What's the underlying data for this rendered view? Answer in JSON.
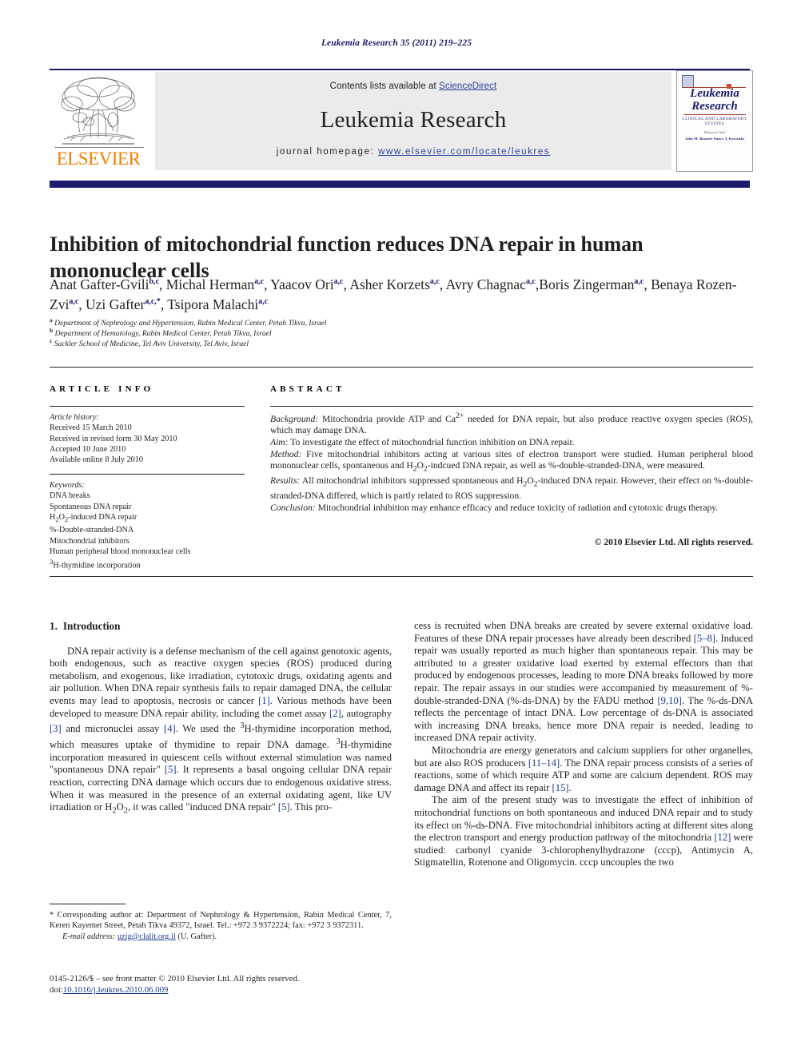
{
  "running_head": "Leukemia Research 35 (2011) 219–225",
  "masthead": {
    "contents_prefix": "Contents lists available at ",
    "sciencedirect": "ScienceDirect",
    "journal_name": "Leukemia Research",
    "homepage_prefix": "journal homepage: ",
    "homepage_url": "www.elsevier.com/locate/leukres",
    "publisher_logo_text": "ELSEVIER",
    "cover": {
      "title_line1": "Leukemia",
      "title_line2": "Research",
      "subtitle": "CLINICAL AND LABORATORY STUDIES",
      "editor_label": "Editors-in-Chief",
      "editor_names": "John M. Bennett    Nancy J. Kowalski"
    }
  },
  "article": {
    "title": "Inhibition of mitochondrial function reduces DNA repair in human mononuclear cells",
    "authors": [
      {
        "name": "Anat Gafter-Gvili",
        "marks": "b,c",
        "sep": ", "
      },
      {
        "name": "Michal Herman",
        "marks": "a,c",
        "sep": ", "
      },
      {
        "name": "Yaacov Ori",
        "marks": "a,c",
        "sep": ", "
      },
      {
        "name": "Asher Korzets",
        "marks": "a,c",
        "sep": ", "
      },
      {
        "name": "Avry Chagnac",
        "marks": "a,c",
        "sep": ","
      },
      {
        "name": "Boris Zingerman",
        "marks": "a,c",
        "sep": ", "
      },
      {
        "name": "Benaya Rozen-Zvi",
        "marks": "a,c",
        "sep": ", "
      },
      {
        "name": "Uzi Gafter",
        "marks": "a,c,*",
        "sep": ", "
      },
      {
        "name": "Tsipora Malachi",
        "marks": "a,c",
        "sep": ""
      }
    ],
    "affiliations": [
      {
        "mark": "a",
        "text": "Department of Nephrology and Hypertension, Rabin Medical Center, Petah Tikva, Israel"
      },
      {
        "mark": "b",
        "text": "Department of Hematology, Rabin Medical Center, Petah Tikva, Israel"
      },
      {
        "mark": "c",
        "text": "Sackler School of Medicine, Tel Aviv University, Tel Aviv, Israel"
      }
    ]
  },
  "article_info": {
    "heading": "ARTICLE INFO",
    "history_label": "Article history:",
    "history": [
      "Received 15 March 2010",
      "Received in revised form 30 May 2010",
      "Accepted 10 June 2010",
      "Available online 8 July 2010"
    ],
    "keywords_label": "Keywords:",
    "keywords": [
      "DNA breaks",
      "Spontaneous DNA repair",
      "H2O2-induced DNA repair",
      "%-Double-stranded-DNA",
      "Mitochondrial inhibitors",
      "Human peripheral blood mononuclear cells",
      "3H-thymidine incorporation"
    ]
  },
  "abstract": {
    "heading": "ABSTRACT",
    "sections": [
      {
        "label": "Background:",
        "text": " Mitochondria provide ATP and Ca2+ needed for DNA repair, but also produce reactive oxygen species (ROS), which may damage DNA."
      },
      {
        "label": "Aim:",
        "text": " To investigate the effect of mitochondrial function inhibition on DNA repair."
      },
      {
        "label": "Method:",
        "text": " Five mitochondrial inhibitors acting at various sites of electron transport were studied. Human peripheral blood mononuclear cells, spontaneous and H2O2-indcued DNA repair, as well as %-double-stranded-DNA, were measured."
      },
      {
        "label": "Results:",
        "text": " All mitochondrial inhibitors suppressed spontaneous and H2O2-induced DNA repair. However, their effect on %-double-stranded-DNA differed, which is partly related to ROS suppression."
      },
      {
        "label": "Conclusion:",
        "text": " Mitochondrial inhibition may enhance efficacy and reduce toxicity of radiation and cytotoxic drugs therapy."
      }
    ],
    "copyright": "© 2010 Elsevier Ltd. All rights reserved."
  },
  "introduction": {
    "number": "1.",
    "title": "Introduction",
    "left_paragraphs": [
      "DNA repair activity is a defense mechanism of the cell against genotoxic agents, both endogenous, such as reactive oxygen species (ROS) produced during metabolism, and exogenous, like irradiation, cytotoxic drugs, oxidating agents and air pollution. When DNA repair synthesis fails to repair damaged DNA, the cellular events may lead to apoptosis, necrosis or cancer [1]. Various methods have been developed to measure DNA repair ability, including the comet assay [2], autography [3] and micronuclei assay [4]. We used the 3H-thymidine incorporation method, which measures uptake of thymidine to repair DNA damage. 3H-thymidine incorporation measured in quiescent cells without external stimulation was named \"spontaneous DNA repair\" [5]. It represents a basal ongoing cellular DNA repair reaction, correcting DNA damage which occurs due to endogenous oxidative stress. When it was measured in the presence of an external oxidating agent, like UV irradiation or H2O2, it was called \"induced DNA repair\" [5]. This pro-"
    ],
    "right_paragraphs": [
      "cess is recruited when DNA breaks are created by severe external oxidative load. Features of these DNA repair processes have already been described [5–8]. Induced repair was usually reported as much higher than spontaneous repair. This may be attributed to a greater oxidative load exerted by external effectors than that produced by endogenous processes, leading to more DNA breaks followed by more repair. The repair assays in our studies were accompanied by measurement of %-double-stranded-DNA (%-ds-DNA) by the FADU method [9,10]. The %-ds-DNA reflects the percentage of intact DNA. Low percentage of ds-DNA is associated with increasing DNA breaks, hence more DNA repair is needed, leading to increased DNA repair activity.",
      "Mitochondria are energy generators and calcium suppliers for other organelles, but are also ROS producers [11–14]. The DNA repair process consists of a series of reactions, some of which require ATP and some are calcium dependent. ROS may damage DNA and affect its repair [15].",
      "The aim of the present study was to investigate the effect of inhibition of mitochondrial functions on both spontaneous and induced DNA repair and to study its effect on %-ds-DNA. Five mitochondrial inhibitors acting at different sites along the electron transport and energy production pathway of the mitochondria [12] were studied: carbonyl cyanide 3-chlorophenylhydrazone (cccp), Antimycin A, Stigmatellin, Rotenone and Oligomycin. cccp uncouples the two"
    ]
  },
  "footnote": {
    "corresponding_star": "*",
    "corresponding_text": " Corresponding author at: Department of Nephrology & Hypertension, Rabin Medical Center, 7, Keren Kayemet Street, Petah Tikva 49372, Israel. Tel.: +972 3 9372224; fax: +972 3 9372311.",
    "email_label": "E-mail address:",
    "email": "uzig@clalit.org.il",
    "email_owner": " (U. Gafter)."
  },
  "imprint": {
    "issn_line": "0145-2126/$ – see front matter © 2010 Elsevier Ltd. All rights reserved.",
    "doi_label": "doi:",
    "doi": "10.1016/j.leukres.2010.06.009"
  },
  "colors": {
    "journal_blue": "#1a1a6e",
    "link_blue": "#2a3f9d",
    "ref_blue": "#1a3a8f",
    "elsevier_orange": "#f08000",
    "panel_grey": "#ebebeb"
  }
}
